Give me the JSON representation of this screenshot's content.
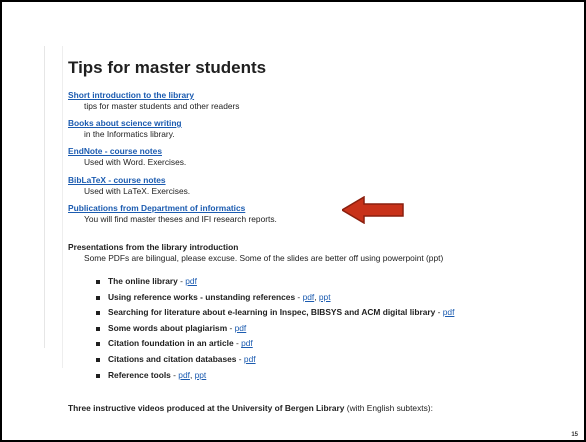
{
  "page": {
    "title": "Tips for master students",
    "slide_number": "15"
  },
  "links": [
    {
      "label": "Short introduction to the library",
      "desc": "tips for master students and other readers"
    },
    {
      "label": "Books about science writing",
      "desc": "in the Informatics library."
    },
    {
      "label": "EndNote - course notes",
      "desc": "Used with Word. Exercises."
    },
    {
      "label": "BibLaTeX - course notes",
      "desc": "Used with LaTeX. Exercises."
    },
    {
      "label": "Publications from Department of informatics",
      "desc": "You will find master theses and IFI research reports."
    }
  ],
  "presentations": {
    "heading": "Presentations from the library introduction",
    "desc": "Some PDFs are bilingual, please excuse. Some of the slides are better off using powerpoint (ppt)",
    "separator": " - ",
    "items": [
      {
        "title": "The online library",
        "links": [
          "pdf"
        ]
      },
      {
        "title": "Using reference works - unstanding references",
        "links": [
          "pdf",
          "ppt"
        ]
      },
      {
        "title": "Searching for literature about e-learning in Inspec, BIBSYS and ACM digital library",
        "links": [
          "pdf"
        ]
      },
      {
        "title": "Some words about plagiarism",
        "links": [
          "pdf"
        ]
      },
      {
        "title": "Citation foundation in an article",
        "links": [
          "pdf"
        ]
      },
      {
        "title": "Citations and citation databases",
        "links": [
          "pdf"
        ]
      },
      {
        "title": "Reference tools",
        "links": [
          "pdf",
          "ppt"
        ]
      }
    ]
  },
  "videos": {
    "bold": "Three instructive videos produced at the University of Bergen Library",
    "rest": " (with English subtexts):"
  },
  "colors": {
    "link": "#1b5bb0",
    "arrow_fill": "#c8321a",
    "arrow_stroke": "#8a1f0e"
  }
}
